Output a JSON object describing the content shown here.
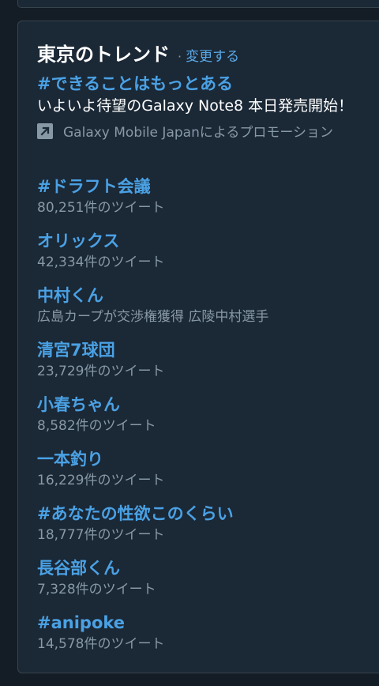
{
  "header": {
    "title": "東京のトレンド",
    "separator": "·",
    "change_label": "変更する"
  },
  "promoted": {
    "name": "#できることはもっとある",
    "description": "いよいよ待望のGalaxy Note8 本日発売開始！",
    "icon": "promoted-arrow-icon",
    "promoter": "Galaxy Mobile Japanによるプロモーション"
  },
  "trends": [
    {
      "name": "#ドラフト会議",
      "sub": "80,251件のツイート"
    },
    {
      "name": "オリックス",
      "sub": "42,334件のツイート"
    },
    {
      "name": "中村くん",
      "sub": "広島カープが交渉権獲得 広陵中村選手"
    },
    {
      "name": "清宮7球団",
      "sub": "23,729件のツイート"
    },
    {
      "name": "小春ちゃん",
      "sub": "8,582件のツイート"
    },
    {
      "name": "一本釣り",
      "sub": "16,229件のツイート"
    },
    {
      "name": "#あなたの性欲このくらい",
      "sub": "18,777件のツイート"
    },
    {
      "name": "長谷部くん",
      "sub": "7,328件のツイート"
    },
    {
      "name": "#anipoke",
      "sub": "14,578件のツイート"
    }
  ],
  "colors": {
    "background": "#141d26",
    "card": "#1b2836",
    "accent": "#4aa1e4",
    "muted": "#8899a6"
  }
}
